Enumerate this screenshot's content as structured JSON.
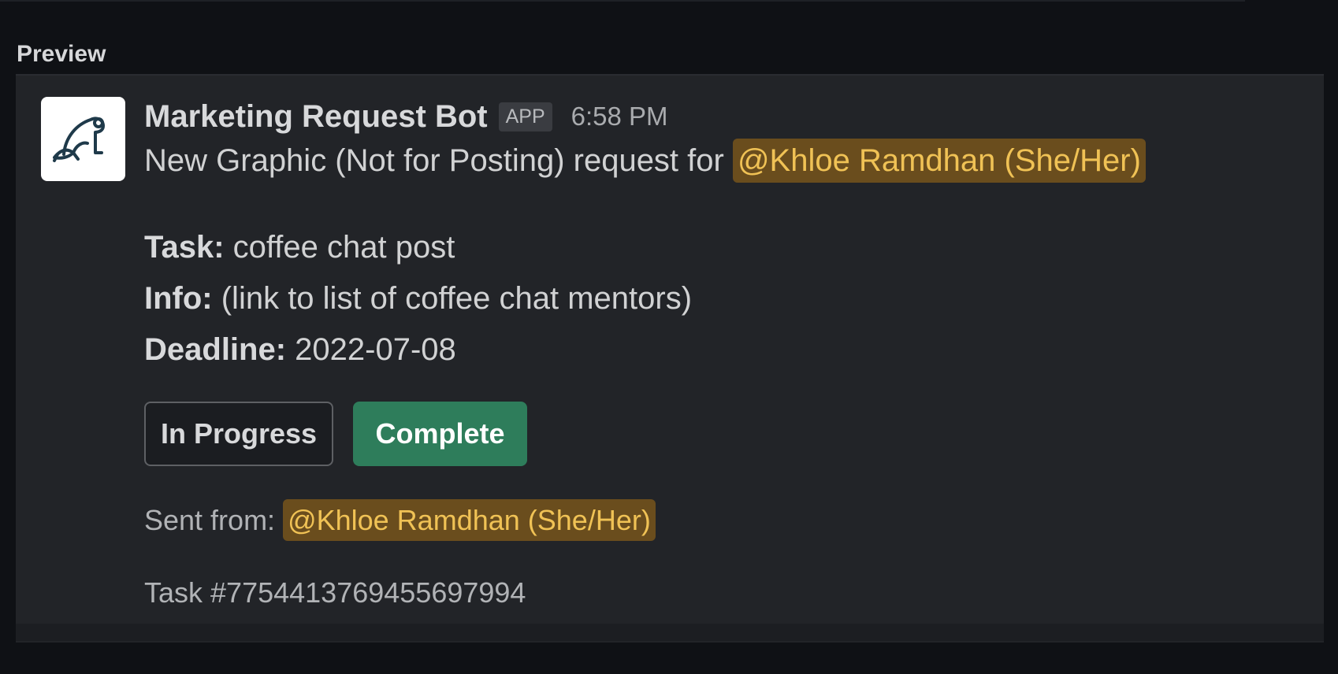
{
  "preview": {
    "label": "Preview"
  },
  "message": {
    "bot_name": "Marketing Request Bot",
    "badge": "APP",
    "time": "6:58 PM",
    "avatar_icon": "frog-logo-icon",
    "intro_text": "New Graphic (Not for Posting) request for ",
    "intro_mention": "@Khloe Ramdhan (She/Her)",
    "task_label": "Task:",
    "task_value": " coffee chat post",
    "info_label": "Info:",
    "info_value": " (link to list of coffee chat mentors)",
    "deadline_label": "Deadline:",
    "deadline_value": " 2022-07-08",
    "sent_from_label": "Sent from: ",
    "sent_from_mention": "@Khloe Ramdhan (She/Her)",
    "task_id": "Task #7754413769455697994"
  },
  "buttons": {
    "in_progress": "In Progress",
    "complete": "Complete"
  },
  "colors": {
    "background": "#0f1115",
    "panel": "#222428",
    "mention_bg": "#6a4d1d",
    "mention_text": "#f0c255",
    "complete_button": "#2e7d5b"
  }
}
